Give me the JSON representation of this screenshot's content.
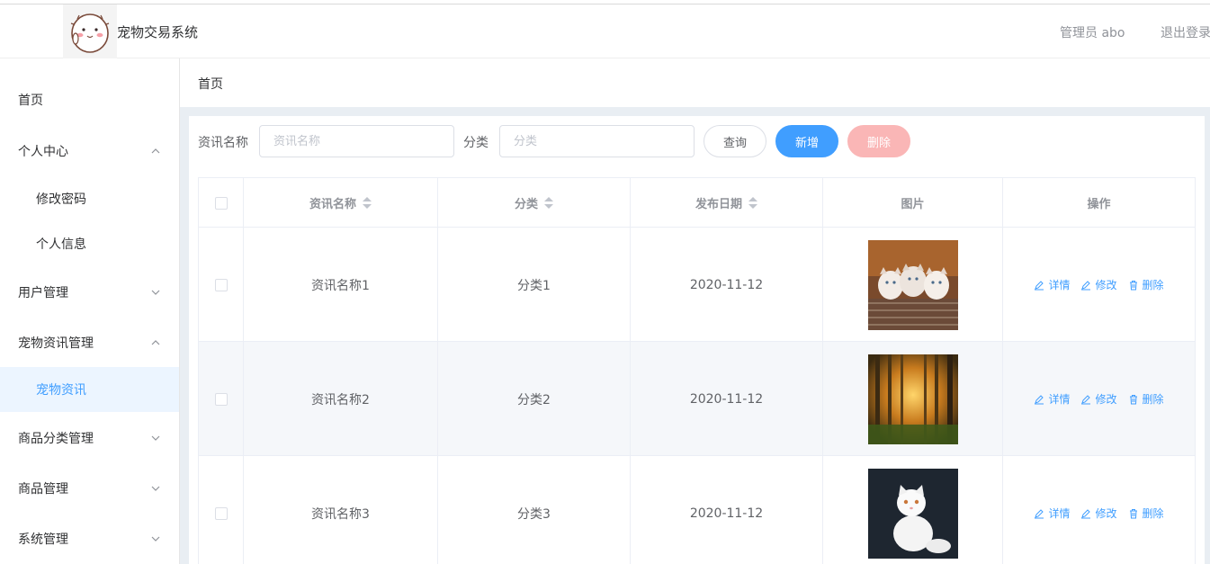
{
  "header": {
    "app_title": "宠物交易系统",
    "user_label": "管理员 abo",
    "logout_label": "退出登录"
  },
  "sidebar": {
    "items": [
      {
        "label": "首页",
        "type": "top"
      },
      {
        "label": "个人中心",
        "type": "group",
        "expanded": true
      },
      {
        "label": "修改密码",
        "type": "sub"
      },
      {
        "label": "个人信息",
        "type": "sub"
      },
      {
        "label": "用户管理",
        "type": "group",
        "expanded": false
      },
      {
        "label": "宠物资讯管理",
        "type": "group",
        "expanded": true
      },
      {
        "label": "宠物资讯",
        "type": "sub",
        "active": true
      },
      {
        "label": "商品分类管理",
        "type": "group",
        "expanded": false
      },
      {
        "label": "商品管理",
        "type": "group",
        "expanded": false
      },
      {
        "label": "系统管理",
        "type": "group",
        "expanded": false
      }
    ]
  },
  "breadcrumb": "首页",
  "filters": {
    "name_label": "资讯名称",
    "name_placeholder": "资讯名称",
    "category_label": "分类",
    "category_placeholder": "分类"
  },
  "buttons": {
    "query": "查询",
    "add": "新增",
    "delete": "删除"
  },
  "table": {
    "columns": [
      "资讯名称",
      "分类",
      "发布日期",
      "图片",
      "操作"
    ],
    "rows": [
      {
        "name": "资讯名称1",
        "category": "分类1",
        "date": "2020-11-12",
        "image": "kittens-in-basket"
      },
      {
        "name": "资讯名称2",
        "category": "分类2",
        "date": "2020-11-12",
        "image": "sunlit-forest"
      },
      {
        "name": "资讯名称3",
        "category": "分类3",
        "date": "2020-11-12",
        "image": "white-persian-cat"
      }
    ],
    "actions": {
      "detail": "详情",
      "edit": "修改",
      "delete": "删除"
    }
  },
  "colors": {
    "primary": "#409eff",
    "danger_light": "#fab6b6",
    "active_bg": "#ecf5ff",
    "content_bg": "#e9eef3"
  }
}
